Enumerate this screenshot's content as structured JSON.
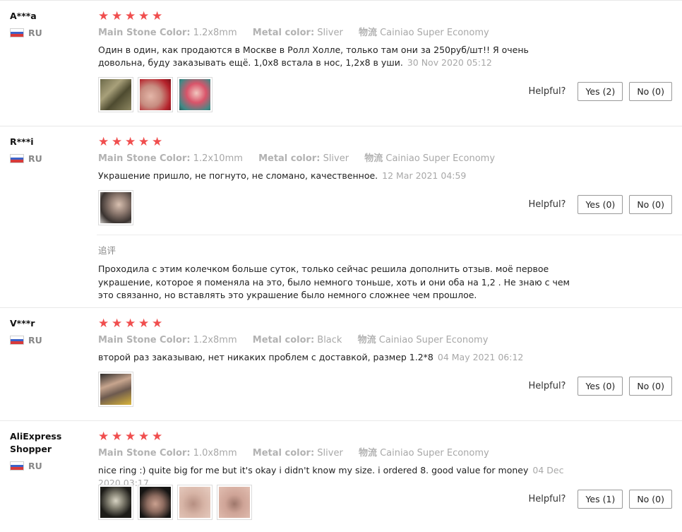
{
  "reviews": [
    {
      "user": "A***a",
      "country": "RU",
      "stars": 5,
      "props": [
        {
          "key": "Main Stone Color:",
          "value": "1.2x8mm"
        },
        {
          "key": "Metal color:",
          "value": "Sliver"
        },
        {
          "key": "物流",
          "value": "Cainiao Super Economy"
        }
      ],
      "text": "Один в один, как продаются в Москве в Ролл Холле, только там они за 250руб/шт!! Я очень довольна, буду заказывать ещё. 1,0х8 встала в нос, 1,2х8 в уши.",
      "date": "30 Nov 2020 05:12",
      "helpful_label": "Helpful?",
      "yes_label": "Yes (2)",
      "no_label": "No (0)"
    },
    {
      "user": "R***i",
      "country": "RU",
      "stars": 5,
      "props": [
        {
          "key": "Main Stone Color:",
          "value": "1.2x10mm"
        },
        {
          "key": "Metal color:",
          "value": "Sliver"
        },
        {
          "key": "物流",
          "value": "Cainiao Super Economy"
        }
      ],
      "text": "Украшение пришло, не погнуто, не сломано, качественное.",
      "date": "12 Mar 2021 04:59",
      "helpful_label": "Helpful?",
      "yes_label": "Yes (0)",
      "no_label": "No (0)",
      "followup_title": "追评",
      "followup_text": "Проходила с этим колечком больше суток, только сейчас решила дополнить отзыв. моё первое украшение, которое я поменяла на это, было немного тоньше, хоть и они оба на 1,2 . Не знаю с чем это связанно, но вставлять это украшение было немного сложнее чем прошлое."
    },
    {
      "user": "V***r",
      "country": "RU",
      "stars": 5,
      "props": [
        {
          "key": "Main Stone Color:",
          "value": "1.2x8mm"
        },
        {
          "key": "Metal color:",
          "value": "Black"
        },
        {
          "key": "物流",
          "value": "Cainiao Super Economy"
        }
      ],
      "text": "второй раз заказываю, нет никаких проблем с доставкой, размер 1.2*8",
      "date": "04 May 2021 06:12",
      "helpful_label": "Helpful?",
      "yes_label": "Yes (0)",
      "no_label": "No (0)"
    },
    {
      "user": "AliExpress Shopper",
      "country": "RU",
      "stars": 5,
      "props": [
        {
          "key": "Main Stone Color:",
          "value": "1.0x8mm"
        },
        {
          "key": "Metal color:",
          "value": "Sliver"
        },
        {
          "key": "物流",
          "value": "Cainiao Super Economy"
        }
      ],
      "text": "nice ring :) quite big for me but it's okay i didn't know my size. i ordered 8. good value for money",
      "date": "04 Dec 2020 03:17",
      "helpful_label": "Helpful?",
      "yes_label": "Yes (1)",
      "no_label": "No (0)"
    }
  ],
  "colors": {
    "star": "#f04e4e",
    "muted_text": "#a8a8a8",
    "flag_blue": "#3c63c9",
    "flag_red": "#d83a3a"
  },
  "icons": {
    "star": "star-icon",
    "flag": "russia-flag-icon"
  }
}
